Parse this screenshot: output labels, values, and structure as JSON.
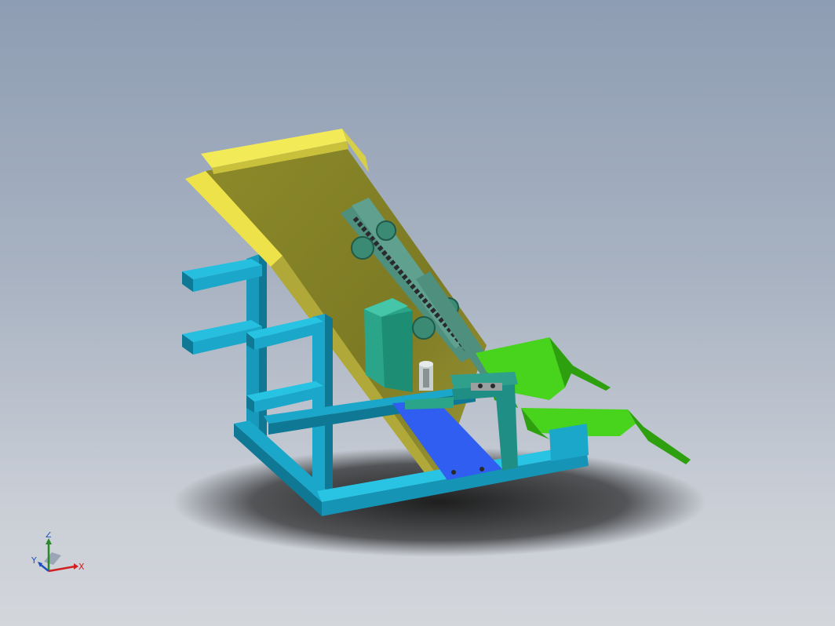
{
  "viewport": {
    "background_top": "#8e9db3",
    "background_bottom": "#d3d6db"
  },
  "model": {
    "colors": {
      "chute_light": "#f2ea55",
      "chute_dark": "#9a9a2a",
      "frame": "#19a9c9",
      "frame_dark": "#0d7c98",
      "guard": "#3fd21c",
      "guard_dark": "#2aa010",
      "block": "#2aa58a",
      "base_plate": "#2f5ef0",
      "chain": "#5c8f7a"
    }
  },
  "triad": {
    "z_label": "Z",
    "x_label": "X",
    "y_label": "Y",
    "z_color": "#2a8a2a",
    "x_color": "#d02020",
    "y_color": "#2050c0"
  }
}
